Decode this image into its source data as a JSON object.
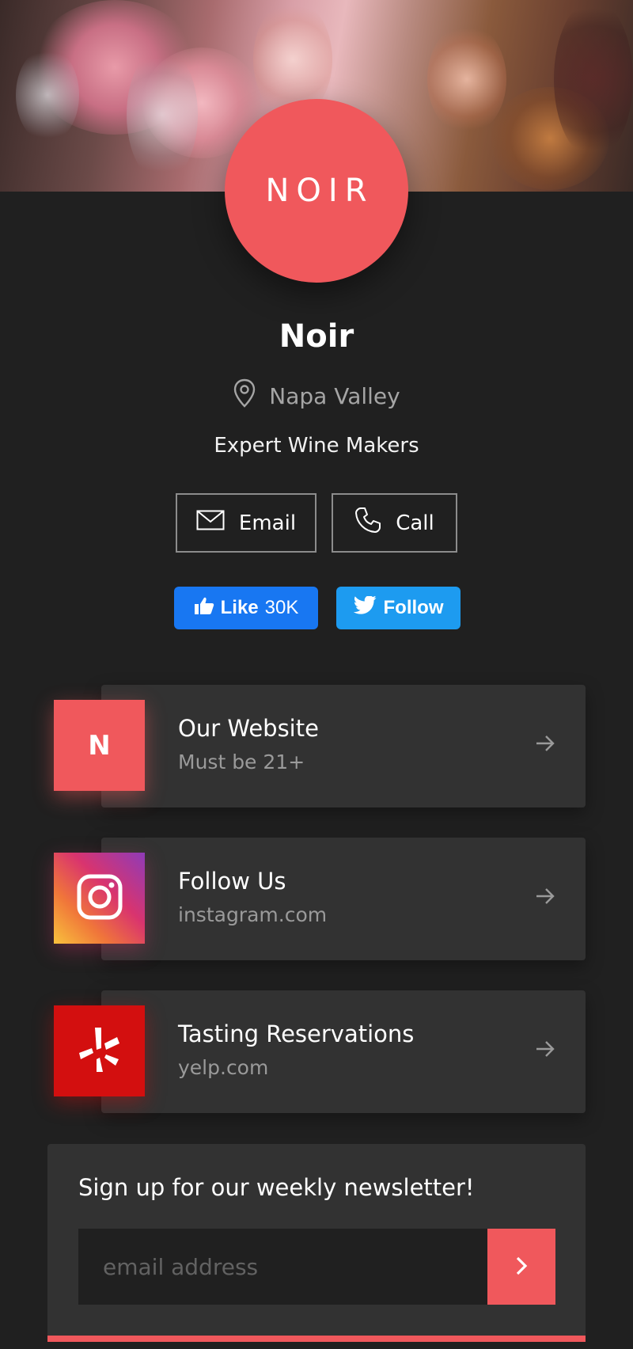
{
  "profile": {
    "logo_text": "NOIR",
    "name": "Noir",
    "location": "Napa Valley",
    "tagline": "Expert Wine Makers"
  },
  "contact": {
    "email_label": "Email",
    "call_label": "Call"
  },
  "social": {
    "like_label": "Like",
    "like_count": "30K",
    "follow_label": "Follow",
    "facebook_color": "#1877f2",
    "twitter_color": "#1da1f2"
  },
  "links": [
    {
      "title": "Our Website",
      "subtitle": "Must be 21+",
      "tile_letter": "N",
      "icon": "noir-n-icon",
      "color": "#f0585c"
    },
    {
      "title": "Follow Us",
      "subtitle": "instagram.com",
      "icon": "instagram-icon",
      "color": "#c13584"
    },
    {
      "title": "Tasting Reservations",
      "subtitle": "yelp.com",
      "icon": "yelp-icon",
      "color": "#d32323"
    }
  ],
  "newsletter": {
    "title": "Sign up for our weekly newsletter!",
    "placeholder": "email address"
  },
  "colors": {
    "accent": "#f0585c",
    "background": "#202020",
    "card": "#323232"
  }
}
